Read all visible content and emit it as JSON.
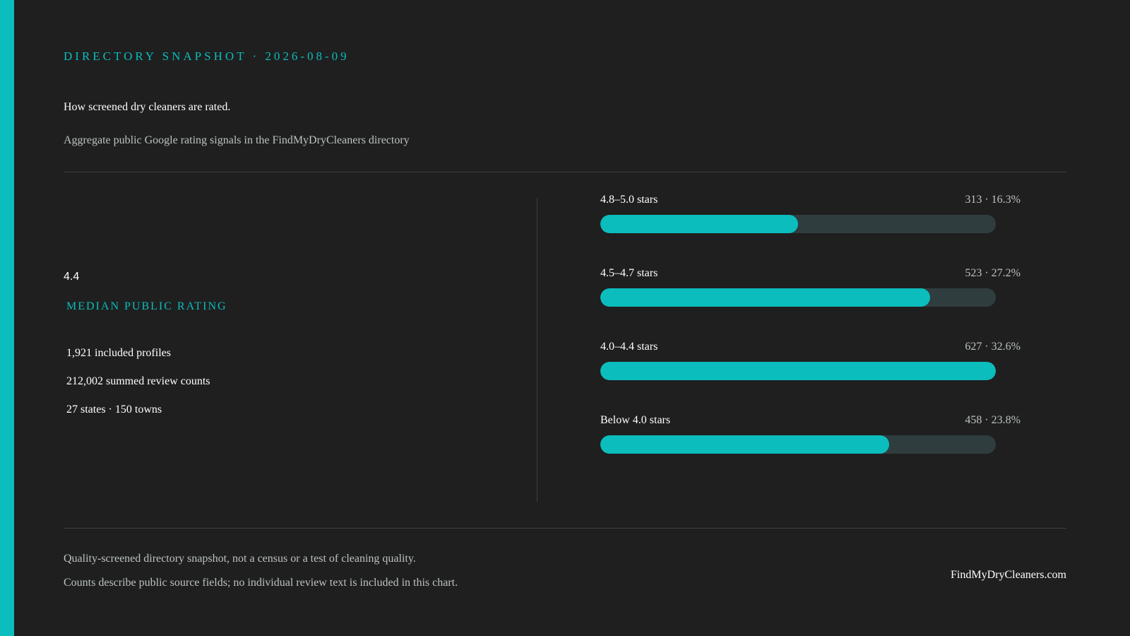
{
  "header": {
    "eyebrow": "DIRECTORY SNAPSHOT · 2026-08-09",
    "headline": "How screened dry cleaners are rated.",
    "subhead": "Aggregate public Google rating signals in the FindMyDryCleaners directory"
  },
  "kpi": {
    "value": "4.4",
    "label": "MEDIAN PUBLIC RATING",
    "stats": [
      "1,921 included profiles",
      "212,002 summed review counts",
      "27 states · 150 towns"
    ]
  },
  "chart_data": {
    "type": "bar",
    "orientation": "horizontal",
    "title": "",
    "xlabel": "",
    "ylabel": "",
    "categories": [
      "4.8–5.0 stars",
      "4.5–4.7 stars",
      "4.0–4.4 stars",
      "Below 4.0 stars"
    ],
    "values": [
      313,
      523,
      627,
      458
    ],
    "percents": [
      16.3,
      27.2,
      32.6,
      23.8
    ],
    "value_labels": [
      "313 · 16.3%",
      "523 · 27.2%",
      "627 · 32.6%",
      "458 · 23.8%"
    ],
    "xlim": [
      0,
      627
    ],
    "grid": false,
    "legend": "none"
  },
  "footer": {
    "note_1": "Quality-screened directory snapshot, not a census or a test of cleaning quality.",
    "note_2": "Counts describe public source fields; no individual review text is included in this chart.",
    "brand": "FindMyDryCleaners.com"
  },
  "colors": {
    "background": "#1f1f1f",
    "accent": "#0bbdbd",
    "track": "#2f3d3f",
    "muted_text": "#bcc2c2"
  }
}
